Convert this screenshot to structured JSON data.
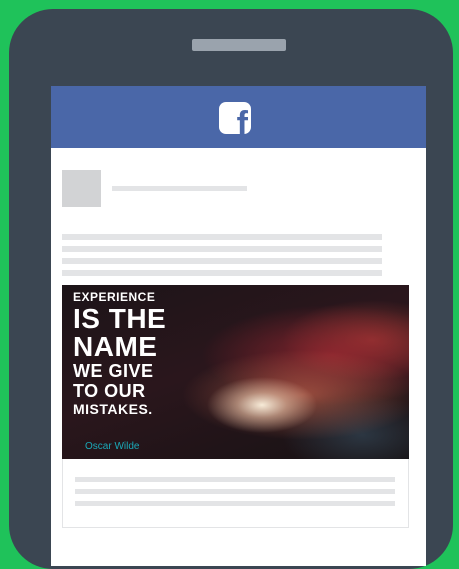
{
  "header": {
    "logo_glyph": "f",
    "icon": "facebook-logo-icon"
  },
  "post": {
    "quote_lines": [
      "EXPERIENCE",
      "IS THE",
      "NAME",
      "WE GIVE",
      "TO OUR",
      "MISTAKES."
    ],
    "author": "Oscar Wilde"
  },
  "colors": {
    "background": "#1fc25a",
    "phone_body": "#3b4652",
    "facebook_blue": "#4a67a8",
    "placeholder": "#e3e4e6",
    "author_text": "#1aa9b8"
  }
}
